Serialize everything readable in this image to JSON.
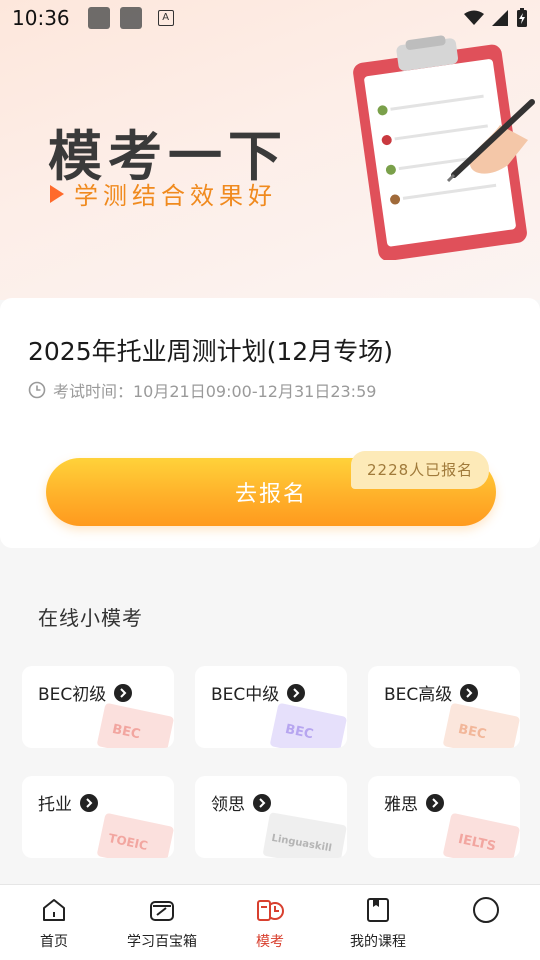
{
  "status_bar": {
    "time": "10:36",
    "a_icon": "A"
  },
  "hero": {
    "title": "模考一下",
    "subtitle": "学测结合效果好"
  },
  "exam": {
    "title": "2025年托业周测计划(12月专场)",
    "time_text": "考试时间：10月21日09:00-12月31日23:59",
    "button_label": "去报名",
    "signup_count": "2228人已报名"
  },
  "mini": {
    "section_title": "在线小模考",
    "tiles": [
      {
        "label": "BEC初级",
        "deco": "BEC",
        "color": "#f2a6a0"
      },
      {
        "label": "BEC中级",
        "deco": "BEC",
        "color": "#b7a6f0"
      },
      {
        "label": "BEC高级",
        "deco": "BEC",
        "color": "#f2b79a"
      },
      {
        "label": "托业",
        "deco": "TOEIC",
        "color": "#f2a6a0"
      },
      {
        "label": "领思",
        "deco": "Linguaskill",
        "color": "#c8c8c8"
      },
      {
        "label": "雅思",
        "deco": "IELTS",
        "color": "#f2a6a0"
      }
    ]
  },
  "nav": {
    "items": [
      {
        "label": "首页",
        "icon": "home-icon"
      },
      {
        "label": "学习百宝箱",
        "icon": "toolbox-icon"
      },
      {
        "label": "模考",
        "icon": "mock-exam-icon"
      },
      {
        "label": "我的课程",
        "icon": "course-icon"
      },
      {
        "label": "",
        "icon": "profile-icon"
      }
    ],
    "active_color": "#d8402f"
  }
}
